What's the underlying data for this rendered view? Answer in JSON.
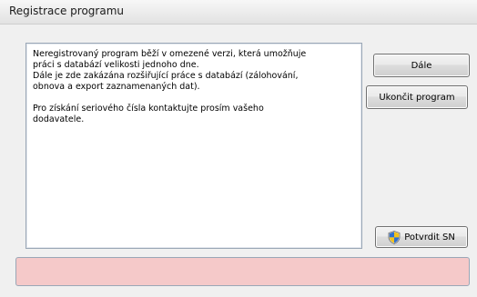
{
  "window": {
    "title": "Registrace programu"
  },
  "message": {
    "lines": [
      "Neregistrovaný program běží v omezené verzi, která umožňuje",
      "práci s databází velikosti jednoho dne.",
      "Dále je zde zakázána rozšiřující práce s databází (zálohování,",
      "obnova a export zaznamenaných dat).",
      "",
      "Pro získání seriového čísla kontaktujte prosím vašeho",
      "dodavatele."
    ]
  },
  "buttons": {
    "next_label": "Dále",
    "exit_label": "Ukončit program",
    "confirm_sn_label": "Potvrdit SN",
    "confirm_sn_icon": "uac-shield-icon"
  },
  "status": {
    "text": "",
    "color": "#f5c9c9"
  }
}
